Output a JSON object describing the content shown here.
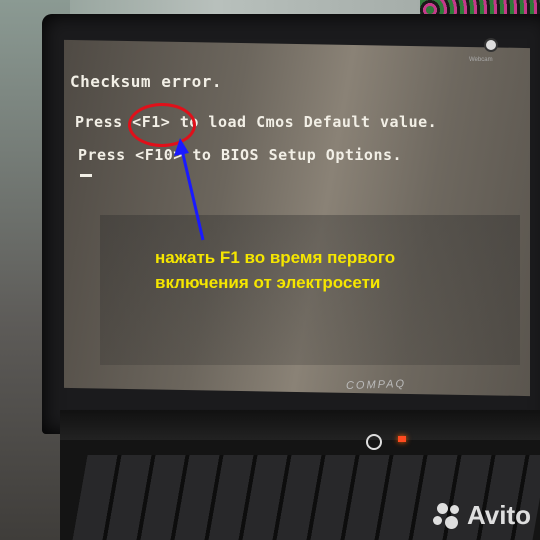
{
  "screen": {
    "lines": [
      "Checksum error.",
      "Press <F1> to load Cmos Default value.",
      "Press <F10> to BIOS Setup Options."
    ],
    "webcam_label": "Webcam"
  },
  "laptop": {
    "brand": "COMPAQ"
  },
  "annotation": {
    "caption_line1": "нажать F1 во время первого",
    "caption_line2": "включения от электросети",
    "circle_color": "#e0101a",
    "arrow_color": "#1a1aff",
    "text_color": "#f5e600"
  },
  "watermark": "Avito"
}
